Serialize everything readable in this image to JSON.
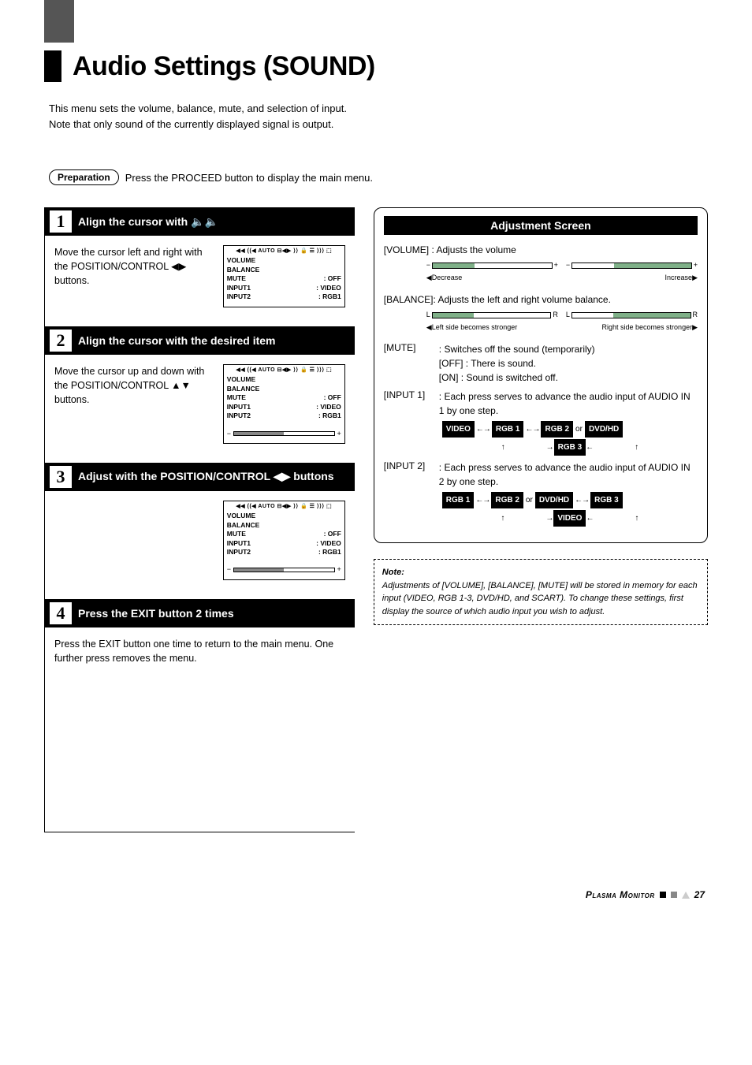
{
  "page_title": "Audio Settings (SOUND)",
  "intro_line1": "This menu sets the volume, balance, mute, and selection of input.",
  "intro_line2": "Note that only sound of the currently displayed signal is output.",
  "prep_badge": "Preparation",
  "prep_text": "Press the PROCEED button to display the main menu.",
  "steps": {
    "s1": {
      "title_pre": "Align the cursor with ",
      "title_icons": "🔈🔈",
      "text": "Move the cursor left and right with the POSITION/CONTROL ◀▶ buttons."
    },
    "s2": {
      "title": "Align the cursor with the desired item",
      "text": "Move the cursor up and down with the POSITION/CONTROL ▲▼ buttons."
    },
    "s3": {
      "title": "Adjust with the POSITION/CONTROL ◀▶ buttons"
    },
    "s4": {
      "title": "Press the EXIT button 2 times",
      "text": "Press the EXIT button one time to return to the main menu. One further press removes the menu."
    }
  },
  "osd": {
    "icon_strip": "◀◀ ((◀ AUTO ⊟◀▶ ⟩⟩ 🔒 ☰ ⟩⟩⟩ ⬚",
    "volume": "VOLUME",
    "balance": "BALANCE",
    "mute": "MUTE",
    "mute_val": ": OFF",
    "input1": "INPUT1",
    "input1_val": ": VIDEO",
    "input2": "INPUT2",
    "input2_val": ": RGB1"
  },
  "adj_title": "Adjustment Screen",
  "adj": {
    "vol_label": "[VOLUME]  : Adjusts the volume",
    "vol_dec": "◀Decrease",
    "vol_inc": "Increase▶",
    "bal_label": "[BALANCE]: Adjusts the left and right volume balance.",
    "bal_left": "◀Left side becomes stronger",
    "bal_right": "Right side becomes stronger▶",
    "mute_key": "[MUTE]",
    "mute_l1": ": Switches off the sound (temporarily)",
    "mute_l2": "[OFF] : There is sound.",
    "mute_l3": "[ON]  : Sound is switched off.",
    "in1_key": "[INPUT 1]",
    "in1_l1": ": Each press serves to advance the audio input of AUDIO IN 1 by one step.",
    "in2_key": "[INPUT 2]",
    "in2_l1": ": Each press serves to advance the audio input of AUDIO IN 2 by one step.",
    "tags": {
      "video": "VIDEO",
      "rgb1": "RGB 1",
      "rgb2": "RGB 2",
      "rgb3": "RGB 3",
      "dvdhd": "DVD/HD",
      "or": "or"
    }
  },
  "note_title": "Note:",
  "note_body": "Adjustments of [VOLUME], [BALANCE], [MUTE] will be stored in memory for each input (VIDEO, RGB 1-3, DVD/HD, and SCART). To change these settings, first display the source of which audio input you wish to adjust.",
  "footer_brand": "Plasma Monitor",
  "footer_page": "27"
}
